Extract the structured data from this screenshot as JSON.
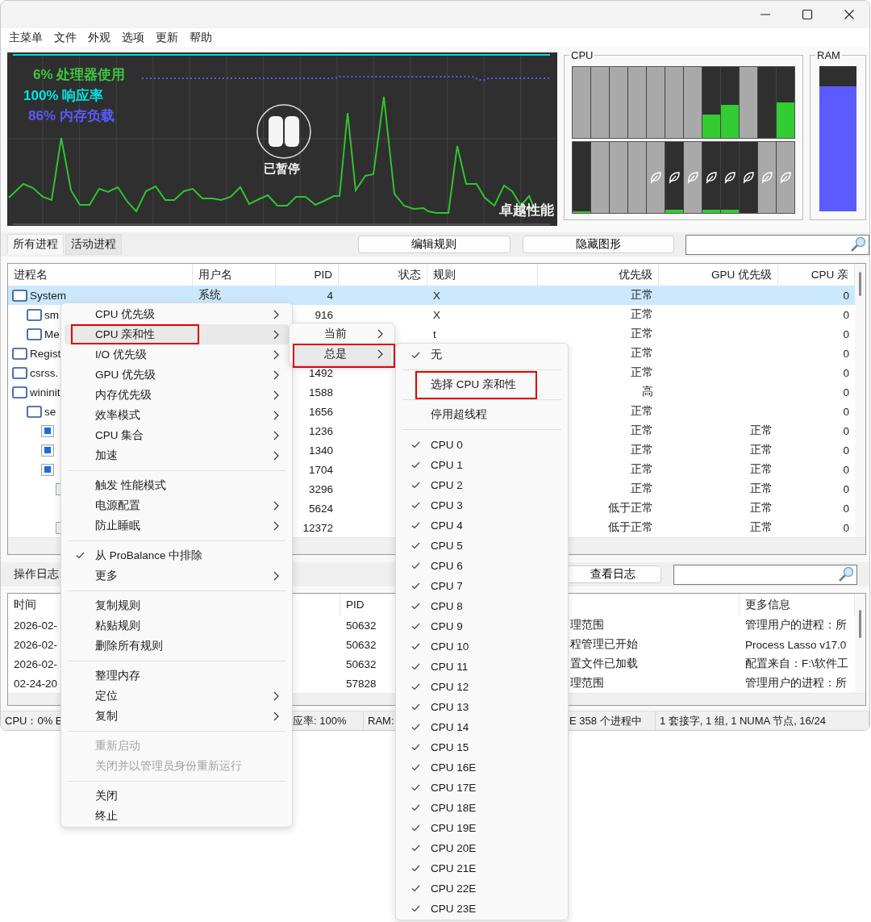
{
  "menu_bar": [
    "主菜单",
    "文件",
    "外观",
    "选项",
    "更新",
    "帮助"
  ],
  "graph": {
    "legend": [
      {
        "text": "6% 处理器使用",
        "color": "#3ec73e"
      },
      {
        "text": "100% 响应率",
        "color": "#00e5e5"
      },
      {
        "text": "86% 内存负载",
        "color": "#5a5aff"
      }
    ],
    "paused_label": "已暂停",
    "power_plan": "卓越性能"
  },
  "cpu_meter": {
    "title": "CPU",
    "rows": [
      [
        {
          "parked": true,
          "level": 0,
          "efficiency": false
        },
        {
          "parked": true,
          "level": 0,
          "efficiency": false
        },
        {
          "parked": true,
          "level": 0,
          "efficiency": false
        },
        {
          "parked": true,
          "level": 0,
          "efficiency": false
        },
        {
          "parked": true,
          "level": 0,
          "efficiency": false
        },
        {
          "parked": true,
          "level": 0,
          "efficiency": false
        },
        {
          "parked": true,
          "level": 0,
          "efficiency": false
        },
        {
          "parked": false,
          "level": 0.33,
          "efficiency": false
        },
        {
          "parked": false,
          "level": 0.47,
          "efficiency": false
        },
        {
          "parked": true,
          "level": 0,
          "efficiency": false
        },
        {
          "parked": false,
          "level": 0,
          "efficiency": false
        },
        {
          "parked": false,
          "level": 0.5,
          "efficiency": false
        }
      ],
      [
        {
          "parked": false,
          "level": 0.02,
          "efficiency": false
        },
        {
          "parked": true,
          "level": 0,
          "efficiency": false
        },
        {
          "parked": true,
          "level": 0,
          "efficiency": false
        },
        {
          "parked": true,
          "level": 0,
          "efficiency": false
        },
        {
          "parked": true,
          "level": 0,
          "efficiency": true
        },
        {
          "parked": false,
          "level": 0.04,
          "efficiency": true
        },
        {
          "parked": true,
          "level": 0,
          "efficiency": true
        },
        {
          "parked": false,
          "level": 0.04,
          "efficiency": true
        },
        {
          "parked": false,
          "level": 0.04,
          "efficiency": true
        },
        {
          "parked": false,
          "level": 0,
          "efficiency": true
        },
        {
          "parked": true,
          "level": 0,
          "efficiency": true
        },
        {
          "parked": true,
          "level": 0,
          "efficiency": true
        }
      ]
    ]
  },
  "ram_meter": {
    "title": "RAM",
    "level": 0.86
  },
  "process_tabs": [
    {
      "label": "所有进程",
      "selected": true
    },
    {
      "label": "活动进程",
      "selected": false
    }
  ],
  "toolbar_buttons": [
    "编辑规则",
    "隐藏图形"
  ],
  "process_table": {
    "columns": [
      "进程名",
      "用户名",
      "PID",
      "状态",
      "规则",
      "优先级",
      "GPU 优先级",
      "CPU 亲"
    ],
    "rows": [
      {
        "name": "System",
        "kind": "window",
        "user": "系统",
        "pid": "4",
        "rule": "X",
        "priority": "正常",
        "cpu_affinity": "0",
        "selected": true,
        "children": [
          {
            "name": "sm",
            "kind": "window",
            "pid": "916",
            "rule": "X",
            "priority": "正常",
            "cpu_affinity": "0",
            "selected": false
          },
          {
            "name": "Me",
            "kind": "window",
            "rule": "t",
            "priority": "正常",
            "cpu_affinity": "0",
            "selected": false
          }
        ]
      },
      {
        "name": "Regist",
        "kind": "window",
        "priority": "正常",
        "cpu_affinity": "0",
        "selected": false
      },
      {
        "name": "csrss.",
        "kind": "window",
        "pid": "1492",
        "priority": "正常",
        "cpu_affinity": "0",
        "selected": false
      },
      {
        "name": "wininit",
        "kind": "window",
        "pid": "1588",
        "priority": "高",
        "cpu_affinity": "0",
        "selected": false,
        "children": [
          {
            "name": "se",
            "kind": "window",
            "pid": "1656",
            "priority": "正常",
            "cpu_affinity": "0",
            "selected": false,
            "children": [
              {
                "kind": "app",
                "pid": "1236",
                "priority": "正常",
                "gpu_priority": "正常",
                "cpu_affinity": "0",
                "selected": false
              },
              {
                "kind": "app",
                "pid": "1340",
                "priority": "正常",
                "gpu_priority": "正常",
                "cpu_affinity": "0",
                "selected": false
              },
              {
                "kind": "app",
                "pid": "1704",
                "priority": "正常",
                "gpu_priority": "正常",
                "cpu_affinity": "0",
                "selected": false,
                "children": [
                  {
                    "kind": "small",
                    "pid": "3296",
                    "priority": "正常",
                    "gpu_priority": "正常",
                    "cpu_affinity": "0",
                    "selected": false,
                    "children": [
                      {
                        "pid": "5624",
                        "priority": "低于正常",
                        "gpu_priority": "正常",
                        "cpu_affinity": "0",
                        "selected": false
                      }
                    ]
                  },
                  {
                    "kind": "small",
                    "pid": "12372",
                    "priority": "低于正常",
                    "gpu_priority": "正常",
                    "cpu_affinity": "0",
                    "selected": false
                  }
                ]
              }
            ]
          }
        ]
      }
    ]
  },
  "log_panel": {
    "title": "操作日志",
    "button": "查看日志"
  },
  "log_table": {
    "time_header": "时间",
    "pid_header": "PID",
    "more_header": "更多信息",
    "rows": [
      {
        "time": "2026-02-",
        "pid": "50632",
        "message": "理范围",
        "more": "管理用户的进程：所"
      },
      {
        "time": "2026-02-",
        "pid": "50632",
        "message": "程管理已开始",
        "more": "Process Lasso v17.0"
      },
      {
        "time": "2026-02-",
        "pid": "50632",
        "message": "置文件已加载",
        "more": "配置来自：F:\\软件工"
      },
      {
        "time": "02-24-20",
        "pid": "57828",
        "message": "理范围",
        "more": "管理用户的进程：所"
      }
    ]
  },
  "status_bar": [
    "CPU：0% E",
    "应率: 100%",
    "RAM:",
    "E 358 个进程中",
    "1 套接字, 1 组, 1 NUMA 节点, 16/24"
  ],
  "context_menu": [
    {
      "kind": "item",
      "label": "CPU 优先级",
      "submenu": true,
      "checked": false,
      "disabled": false,
      "selected": false,
      "outlined": false
    },
    {
      "kind": "item",
      "label": "CPU 亲和性",
      "submenu": true,
      "checked": false,
      "disabled": false,
      "selected": true,
      "outlined": true
    },
    {
      "kind": "item",
      "label": "I/O 优先级",
      "submenu": true,
      "checked": false,
      "disabled": false,
      "selected": false,
      "outlined": false
    },
    {
      "kind": "item",
      "label": "GPU 优先级",
      "submenu": true,
      "checked": false,
      "disabled": false,
      "selected": false,
      "outlined": false
    },
    {
      "kind": "item",
      "label": "内存优先级",
      "submenu": true,
      "checked": false,
      "disabled": false,
      "selected": false,
      "outlined": false
    },
    {
      "kind": "item",
      "label": "效率模式",
      "submenu": true,
      "checked": false,
      "disabled": false,
      "selected": false,
      "outlined": false
    },
    {
      "kind": "item",
      "label": "CPU 集合",
      "submenu": true,
      "checked": false,
      "disabled": false,
      "selected": false,
      "outlined": false
    },
    {
      "kind": "item",
      "label": "加速",
      "submenu": true,
      "checked": false,
      "disabled": false,
      "selected": false,
      "outlined": false
    },
    {
      "kind": "separator"
    },
    {
      "kind": "item",
      "label": "触发 性能模式",
      "submenu": false,
      "checked": false,
      "disabled": false,
      "selected": false,
      "outlined": false
    },
    {
      "kind": "item",
      "label": "电源配置",
      "submenu": true,
      "checked": false,
      "disabled": false,
      "selected": false,
      "outlined": false
    },
    {
      "kind": "item",
      "label": "防止睡眠",
      "submenu": true,
      "checked": false,
      "disabled": false,
      "selected": false,
      "outlined": false
    },
    {
      "kind": "separator"
    },
    {
      "kind": "item",
      "label": "从 ProBalance 中排除",
      "submenu": false,
      "checked": true,
      "disabled": false,
      "selected": false,
      "outlined": false
    },
    {
      "kind": "item",
      "label": "更多",
      "submenu": true,
      "checked": false,
      "disabled": false,
      "selected": false,
      "outlined": false
    },
    {
      "kind": "separator"
    },
    {
      "kind": "item",
      "label": "复制规则",
      "submenu": false,
      "checked": false,
      "disabled": false,
      "selected": false,
      "outlined": false
    },
    {
      "kind": "item",
      "label": "粘贴规则",
      "submenu": false,
      "checked": false,
      "disabled": false,
      "selected": false,
      "outlined": false
    },
    {
      "kind": "item",
      "label": "删除所有规则",
      "submenu": false,
      "checked": false,
      "disabled": false,
      "selected": false,
      "outlined": false
    },
    {
      "kind": "separator"
    },
    {
      "kind": "item",
      "label": "整理内存",
      "submenu": false,
      "checked": false,
      "disabled": false,
      "selected": false,
      "outlined": false
    },
    {
      "kind": "item",
      "label": "定位",
      "submenu": true,
      "checked": false,
      "disabled": false,
      "selected": false,
      "outlined": false
    },
    {
      "kind": "item",
      "label": "复制",
      "submenu": true,
      "checked": false,
      "disabled": false,
      "selected": false,
      "outlined": false
    },
    {
      "kind": "separator"
    },
    {
      "kind": "item",
      "label": "重新启动",
      "submenu": false,
      "checked": false,
      "disabled": true,
      "selected": false,
      "outlined": false
    },
    {
      "kind": "item",
      "label": "关闭并以管理员身份重新运行",
      "submenu": false,
      "checked": false,
      "disabled": true,
      "selected": false,
      "outlined": false
    },
    {
      "kind": "separator"
    },
    {
      "kind": "item",
      "label": "关闭",
      "submenu": false,
      "checked": false,
      "disabled": false,
      "selected": false,
      "outlined": false
    },
    {
      "kind": "item",
      "label": "终止",
      "submenu": false,
      "checked": false,
      "disabled": false,
      "selected": false,
      "outlined": false
    }
  ],
  "affinity_submenu": [
    {
      "kind": "item",
      "label": "当前",
      "submenu": true,
      "disabled": false,
      "selected": false,
      "outlined": false
    },
    {
      "kind": "item",
      "label": "总是",
      "submenu": true,
      "disabled": false,
      "selected": true,
      "outlined": true
    }
  ],
  "always_submenu": [
    {
      "kind": "item",
      "label": "无",
      "submenu": false,
      "checked": true,
      "disabled": false,
      "selected": false,
      "outlined": false
    },
    {
      "kind": "separator"
    },
    {
      "kind": "item",
      "label": "选择 CPU 亲和性",
      "submenu": false,
      "checked": false,
      "disabled": false,
      "selected": false,
      "outlined": true
    },
    {
      "kind": "separator"
    },
    {
      "kind": "item",
      "label": "停用超线程",
      "submenu": false,
      "checked": false,
      "disabled": false,
      "selected": false,
      "outlined": false
    },
    {
      "kind": "separator"
    },
    {
      "kind": "item",
      "label": "CPU 0",
      "submenu": false,
      "checked": true,
      "disabled": false,
      "selected": false,
      "outlined": false
    },
    {
      "kind": "item",
      "label": "CPU 1",
      "submenu": false,
      "checked": true,
      "disabled": false,
      "selected": false,
      "outlined": false
    },
    {
      "kind": "item",
      "label": "CPU 2",
      "submenu": false,
      "checked": true,
      "disabled": false,
      "selected": false,
      "outlined": false
    },
    {
      "kind": "item",
      "label": "CPU 3",
      "submenu": false,
      "checked": true,
      "disabled": false,
      "selected": false,
      "outlined": false
    },
    {
      "kind": "item",
      "label": "CPU 4",
      "submenu": false,
      "checked": true,
      "disabled": false,
      "selected": false,
      "outlined": false
    },
    {
      "kind": "item",
      "label": "CPU 5",
      "submenu": false,
      "checked": true,
      "disabled": false,
      "selected": false,
      "outlined": false
    },
    {
      "kind": "item",
      "label": "CPU 6",
      "submenu": false,
      "checked": true,
      "disabled": false,
      "selected": false,
      "outlined": false
    },
    {
      "kind": "item",
      "label": "CPU 7",
      "submenu": false,
      "checked": true,
      "disabled": false,
      "selected": false,
      "outlined": false
    },
    {
      "kind": "item",
      "label": "CPU 8",
      "submenu": false,
      "checked": true,
      "disabled": false,
      "selected": false,
      "outlined": false
    },
    {
      "kind": "item",
      "label": "CPU 9",
      "submenu": false,
      "checked": true,
      "disabled": false,
      "selected": false,
      "outlined": false
    },
    {
      "kind": "item",
      "label": "CPU 10",
      "submenu": false,
      "checked": true,
      "disabled": false,
      "selected": false,
      "outlined": false
    },
    {
      "kind": "item",
      "label": "CPU 11",
      "submenu": false,
      "checked": true,
      "disabled": false,
      "selected": false,
      "outlined": false
    },
    {
      "kind": "item",
      "label": "CPU 12",
      "submenu": false,
      "checked": true,
      "disabled": false,
      "selected": false,
      "outlined": false
    },
    {
      "kind": "item",
      "label": "CPU 13",
      "submenu": false,
      "checked": true,
      "disabled": false,
      "selected": false,
      "outlined": false
    },
    {
      "kind": "item",
      "label": "CPU 14",
      "submenu": false,
      "checked": true,
      "disabled": false,
      "selected": false,
      "outlined": false
    },
    {
      "kind": "item",
      "label": "CPU 15",
      "submenu": false,
      "checked": true,
      "disabled": false,
      "selected": false,
      "outlined": false
    },
    {
      "kind": "item",
      "label": "CPU 16E",
      "submenu": false,
      "checked": true,
      "disabled": false,
      "selected": false,
      "outlined": false
    },
    {
      "kind": "item",
      "label": "CPU 17E",
      "submenu": false,
      "checked": true,
      "disabled": false,
      "selected": false,
      "outlined": false
    },
    {
      "kind": "item",
      "label": "CPU 18E",
      "submenu": false,
      "checked": true,
      "disabled": false,
      "selected": false,
      "outlined": false
    },
    {
      "kind": "item",
      "label": "CPU 19E",
      "submenu": false,
      "checked": true,
      "disabled": false,
      "selected": false,
      "outlined": false
    },
    {
      "kind": "item",
      "label": "CPU 20E",
      "submenu": false,
      "checked": true,
      "disabled": false,
      "selected": false,
      "outlined": false
    },
    {
      "kind": "item",
      "label": "CPU 21E",
      "submenu": false,
      "checked": true,
      "disabled": false,
      "selected": false,
      "outlined": false
    },
    {
      "kind": "item",
      "label": "CPU 22E",
      "submenu": false,
      "checked": true,
      "disabled": false,
      "selected": false,
      "outlined": false
    },
    {
      "kind": "item",
      "label": "CPU 23E",
      "submenu": false,
      "checked": true,
      "disabled": false,
      "selected": false,
      "outlined": false
    }
  ]
}
